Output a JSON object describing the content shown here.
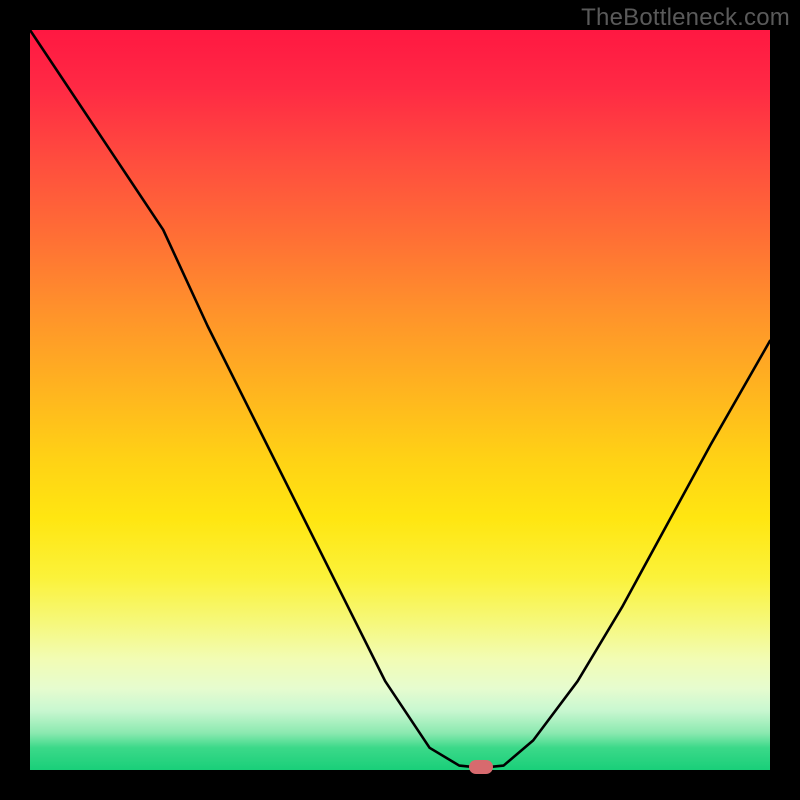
{
  "watermark": "TheBottleneck.com",
  "chart_data": {
    "type": "line",
    "x": [
      0,
      6,
      12,
      18,
      24,
      30,
      36,
      42,
      48,
      54,
      58,
      60,
      62,
      64,
      68,
      74,
      80,
      86,
      92,
      100
    ],
    "values": [
      100,
      91,
      82,
      73,
      60,
      48,
      36,
      24,
      12,
      3,
      0.6,
      0.4,
      0.4,
      0.6,
      4,
      12,
      22,
      33,
      44,
      58
    ],
    "title": "",
    "xlabel": "",
    "ylabel": "",
    "xlim": [
      0,
      100
    ],
    "ylim": [
      0,
      100
    ],
    "annotations": [
      {
        "name": "optimal-marker",
        "x": 61,
        "y": 0.4
      }
    ],
    "background": "heat-gradient-red-to-green"
  }
}
